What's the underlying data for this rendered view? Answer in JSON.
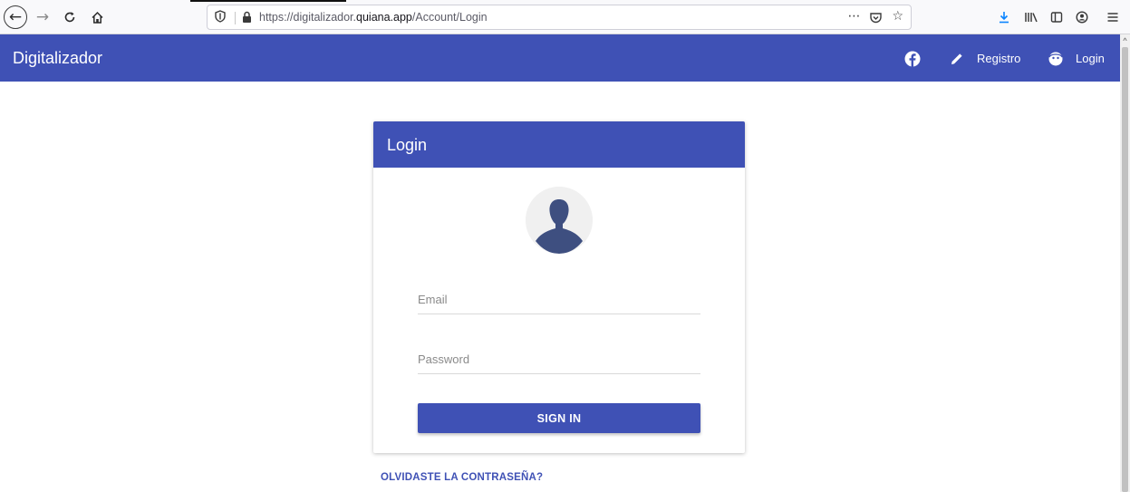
{
  "browser": {
    "url_prefix": "https://digitalizador.",
    "url_domain": "quiana.app",
    "url_path": "/Account/Login",
    "icons": [
      "back-icon",
      "forward-icon",
      "reload-icon",
      "home-icon",
      "shield-icon",
      "lock-icon",
      "more-icon",
      "pocket-icon",
      "bookmark-star-icon",
      "download-icon",
      "library-icon",
      "sidebar-icon",
      "account-icon",
      "menu-icon"
    ],
    "colors": {
      "download_icon": "#0a84ff"
    }
  },
  "header": {
    "brand": "Digitalizador",
    "registro_label": "Registro",
    "login_label": "Login",
    "color": "#3f51b5"
  },
  "card": {
    "title": "Login",
    "email_placeholder": "Email",
    "password_placeholder": "Password",
    "signin_label": "SIGN IN"
  },
  "forgot_label": "OLVIDASTE LA CONTRASEÑA?"
}
